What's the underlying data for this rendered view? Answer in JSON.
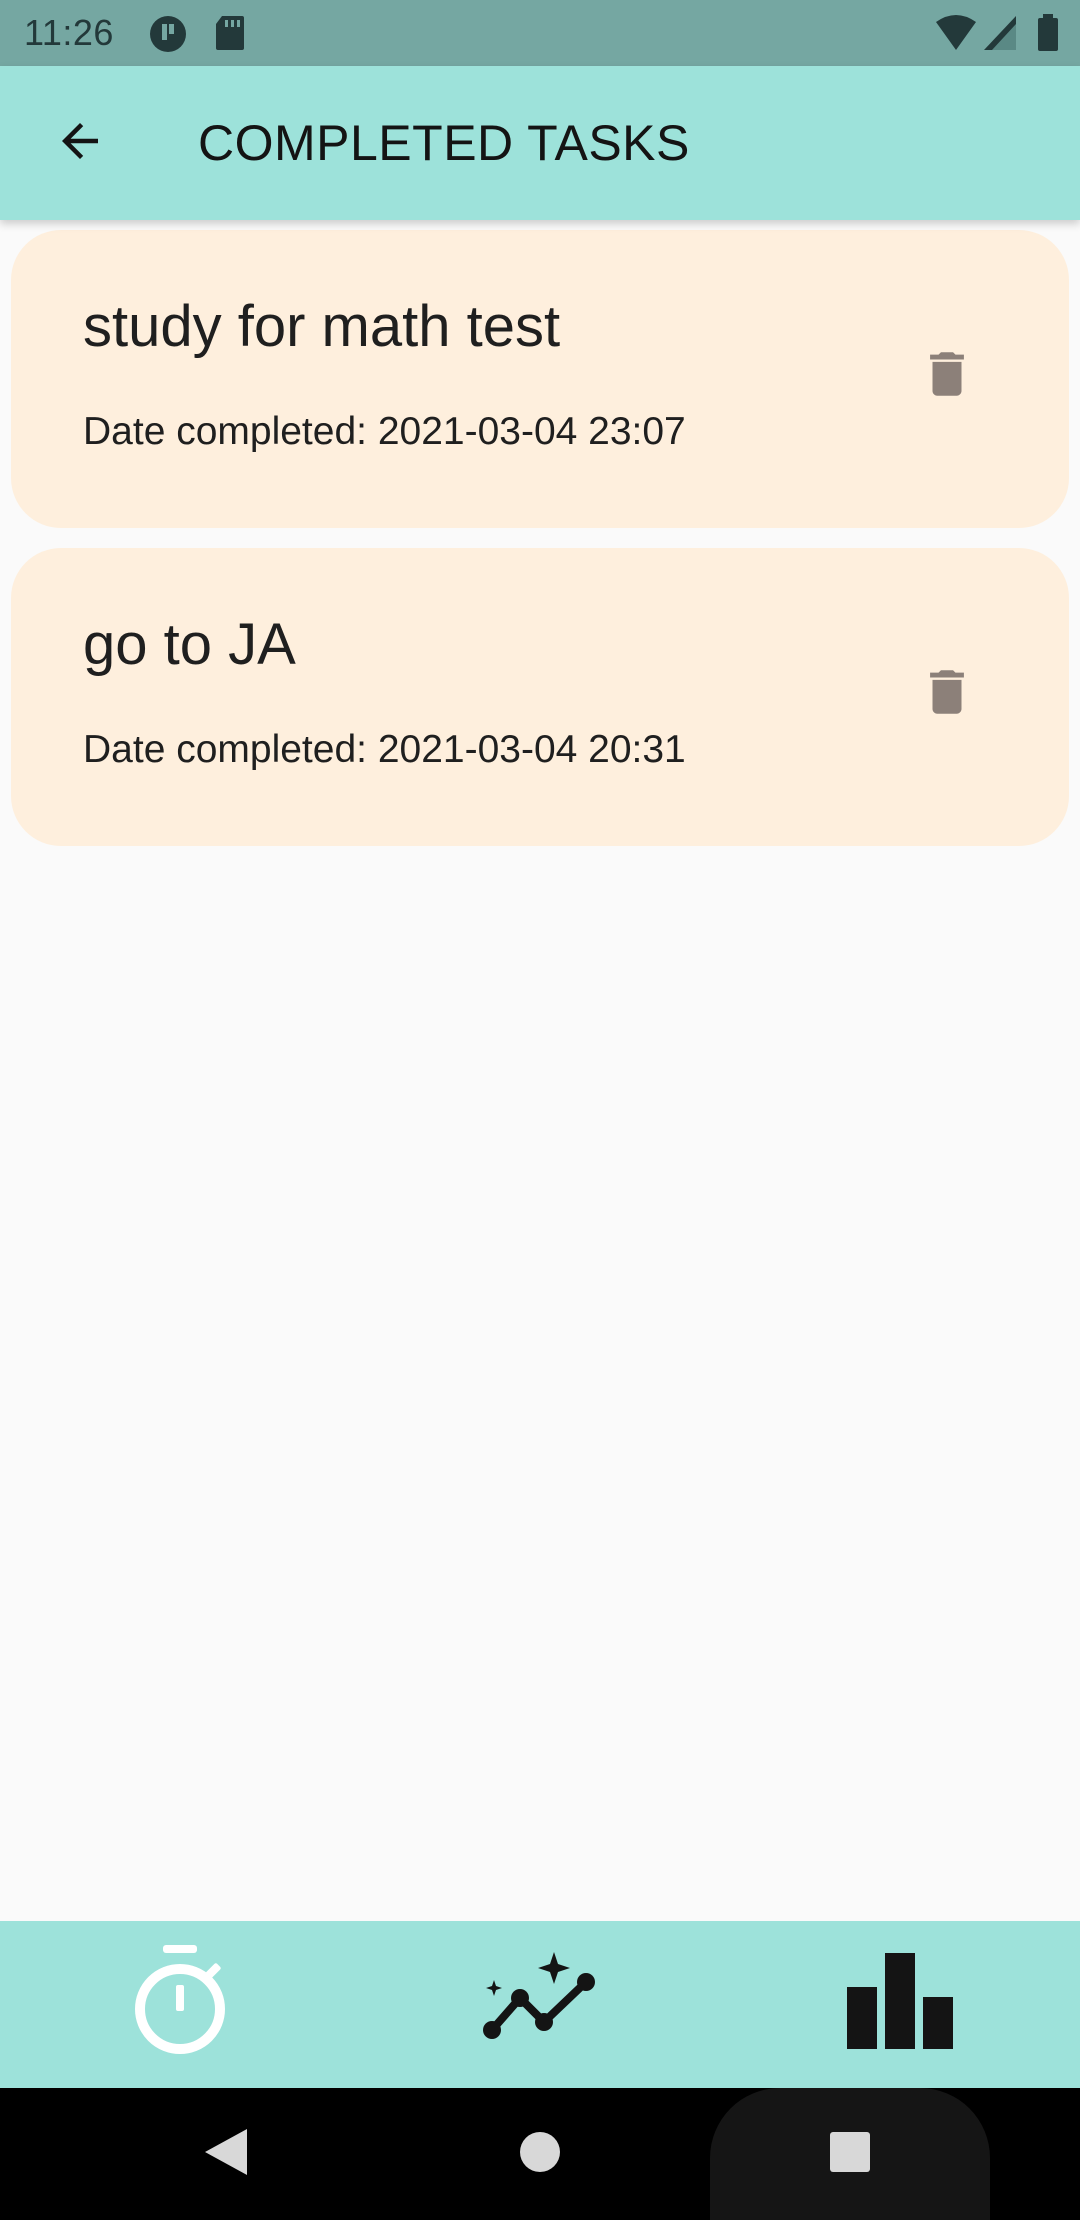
{
  "status_bar": {
    "time": "11:26",
    "icons": [
      "app-notification-icon",
      "sd-card-icon",
      "wifi-icon",
      "signal-icon",
      "battery-icon"
    ]
  },
  "app_bar": {
    "title": "COMPLETED TASKS",
    "back_icon": "arrow-left-icon"
  },
  "tasks": [
    {
      "title": "study for math test",
      "date": "Date completed: 2021-03-04 23:07"
    },
    {
      "title": "go to JA",
      "date": "Date completed: 2021-03-04 20:31"
    }
  ],
  "bottom_nav": {
    "items": [
      "timer-icon",
      "insights-icon",
      "bar-chart-icon"
    ]
  },
  "colors": {
    "status_bar": "#75a7a2",
    "app_bar": "#9de2da",
    "card": "#feefdd",
    "background": "#fafafa",
    "delete_icon": "#8c8079"
  }
}
